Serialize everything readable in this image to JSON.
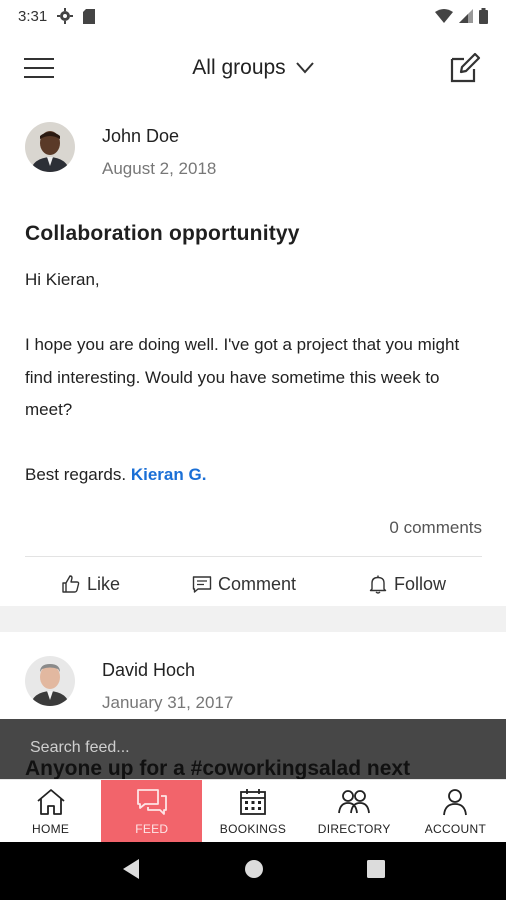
{
  "status_bar": {
    "time": "3:31"
  },
  "header": {
    "group_label": "All groups"
  },
  "posts": [
    {
      "author": "John Doe",
      "date": "August 2, 2018",
      "title": "Collaboration opportunityy",
      "greeting": "Hi Kieran,",
      "body": "I hope you are doing well. I've got a project that you might find interesting. Would you have sometime this week to meet?",
      "signoff": "Best regards.",
      "mention": "Kieran G.",
      "comments": "0 comments",
      "actions": {
        "like": "Like",
        "comment": "Comment",
        "follow": "Follow"
      }
    },
    {
      "author": "David Hoch",
      "date": "January 31, 2017",
      "title_peek": "Anyone up for a #coworkingsalad next"
    }
  ],
  "search": {
    "placeholder": "Search feed..."
  },
  "bottom_nav": [
    {
      "label": "HOME",
      "icon": "home-icon",
      "active": false
    },
    {
      "label": "FEED",
      "icon": "chat-bubbles-icon",
      "active": true
    },
    {
      "label": "BOOKINGS",
      "icon": "calendar-icon",
      "active": false
    },
    {
      "label": "DIRECTORY",
      "icon": "people-icon",
      "active": false
    },
    {
      "label": "ACCOUNT",
      "icon": "person-icon",
      "active": false
    }
  ],
  "colors": {
    "accent": "#f2646b",
    "link": "#1a6fd6",
    "overlay": "#474747"
  }
}
